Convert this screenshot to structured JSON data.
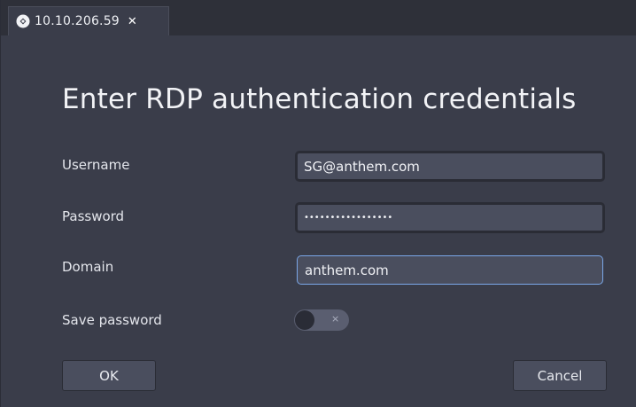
{
  "tab": {
    "icon": "rdp-connection-icon",
    "title": "10.10.206.59",
    "close_label": "✕"
  },
  "dialog": {
    "title": "Enter RDP authentication credentials",
    "username": {
      "label": "Username",
      "value": "SG@anthem.com"
    },
    "password": {
      "label": "Password",
      "value": "•••••••••••••••••"
    },
    "domain": {
      "label": "Domain",
      "value": "anthem.com"
    },
    "save_password": {
      "label": "Save password",
      "enabled": false,
      "off_mark": "×"
    },
    "ok_label": "OK",
    "cancel_label": "Cancel"
  },
  "colors": {
    "background": "#3a3d4a",
    "field": "#4a4e5e",
    "focus_border": "#7aa7e8"
  }
}
